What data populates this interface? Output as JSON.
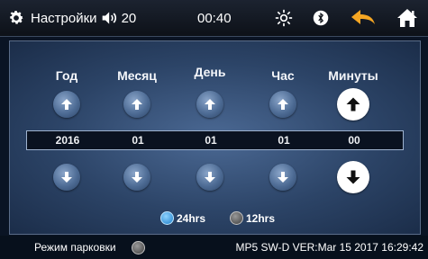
{
  "header": {
    "title": "Настройки",
    "volume": "20",
    "time": "00:40",
    "icons": [
      "gear-icon",
      "speaker-icon",
      "brightness-icon",
      "bluetooth-icon",
      "back-icon",
      "home-icon"
    ],
    "accent_back": "#f5a623"
  },
  "columns": [
    {
      "label": "Год",
      "value": "2016"
    },
    {
      "label": "Месяц",
      "value": "01"
    },
    {
      "label": "День",
      "value": "01"
    },
    {
      "label": "Час",
      "value": "01"
    },
    {
      "label": "Минуты",
      "value": "00"
    }
  ],
  "active_column": 4,
  "format": {
    "option_24": "24hrs",
    "option_12": "12hrs",
    "selected": "24hrs"
  },
  "footer": {
    "parking_label": "Режим парковки",
    "version": "MP5 SW-D VER:Mar 15 2017 16:29:42"
  }
}
